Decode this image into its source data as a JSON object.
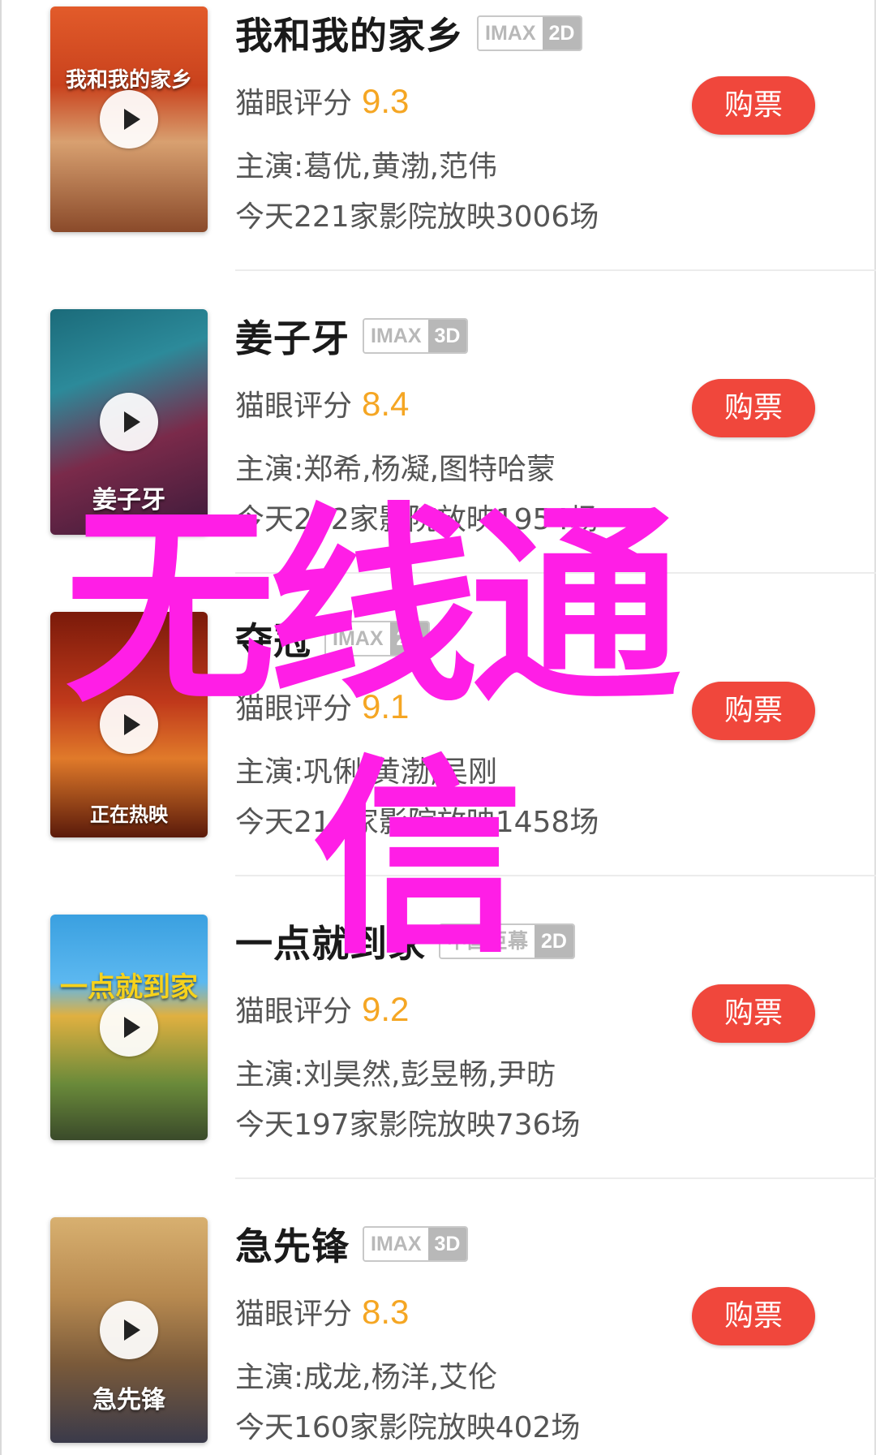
{
  "colors": {
    "buy_button": "#f0473c",
    "rating": "#f5a623",
    "watermark": "#ff1ee6",
    "tag_border": "#c8c8c8"
  },
  "movies": [
    {
      "title": "我和我的家乡",
      "tag_format": "IMAX",
      "tag_dim": "2D",
      "rating_label": "猫眼评分",
      "rating": "9.3",
      "cast": "主演:葛优,黄渤,范伟",
      "shows": "今天221家影院放映3006场",
      "buy_label": "购票",
      "poster_text": "我和我的家乡"
    },
    {
      "title": "姜子牙",
      "tag_format": "IMAX",
      "tag_dim": "3D",
      "rating_label": "猫眼评分",
      "rating": "8.4",
      "cast": "主演:郑希,杨凝,图特哈蒙",
      "shows": "今天212家影院放映1954场",
      "buy_label": "购票",
      "poster_text": "姜子牙"
    },
    {
      "title": "夺冠",
      "tag_format": "IMAX",
      "tag_dim": "2D",
      "rating_label": "猫眼评分",
      "rating": "9.1",
      "cast": "主演:巩俐,黄渤,吴刚",
      "shows": "今天214家影院放映1458场",
      "buy_label": "购票",
      "poster_text": "正在热映"
    },
    {
      "title": "一点就到家",
      "tag_format": "中国巨幕",
      "tag_dim": "2D",
      "rating_label": "猫眼评分",
      "rating": "9.2",
      "cast": "主演:刘昊然,彭昱畅,尹昉",
      "shows": "今天197家影院放映736场",
      "buy_label": "购票",
      "poster_text": "一点就到家"
    },
    {
      "title": "急先锋",
      "tag_format": "IMAX",
      "tag_dim": "3D",
      "rating_label": "猫眼评分",
      "rating": "8.3",
      "cast": "主演:成龙,杨洋,艾伦",
      "shows": "今天160家影院放映402场",
      "buy_label": "购票",
      "poster_text": "急先锋"
    }
  ],
  "watermark": {
    "line1": "无线通",
    "line2": "信"
  }
}
